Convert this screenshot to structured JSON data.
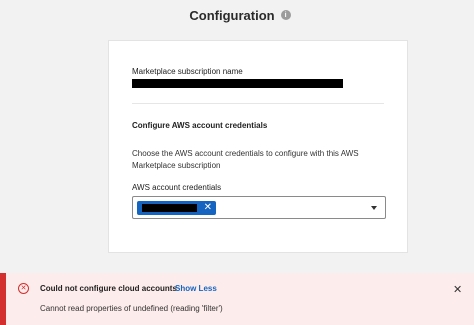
{
  "header": {
    "title": "Configuration",
    "info_icon": "info-circle-icon",
    "info_glyph": "i"
  },
  "form": {
    "subscription_label": "Marketplace subscription name",
    "section_title": "Configure AWS account credentials",
    "description": "Choose the AWS account credentials to configure with this AWS Marketplace subscription",
    "credentials_label": "AWS account credentials",
    "chip_remove": "✕",
    "chip_color": "#1565c0"
  },
  "error_banner": {
    "title": "Could not configure cloud accounts",
    "toggle": "Show Less",
    "message": "Cannot read properties of undefined (reading 'filter')",
    "close": "✕",
    "icon_glyph": "✕",
    "accent_color": "#d32f2f",
    "background": "#fdecec"
  }
}
